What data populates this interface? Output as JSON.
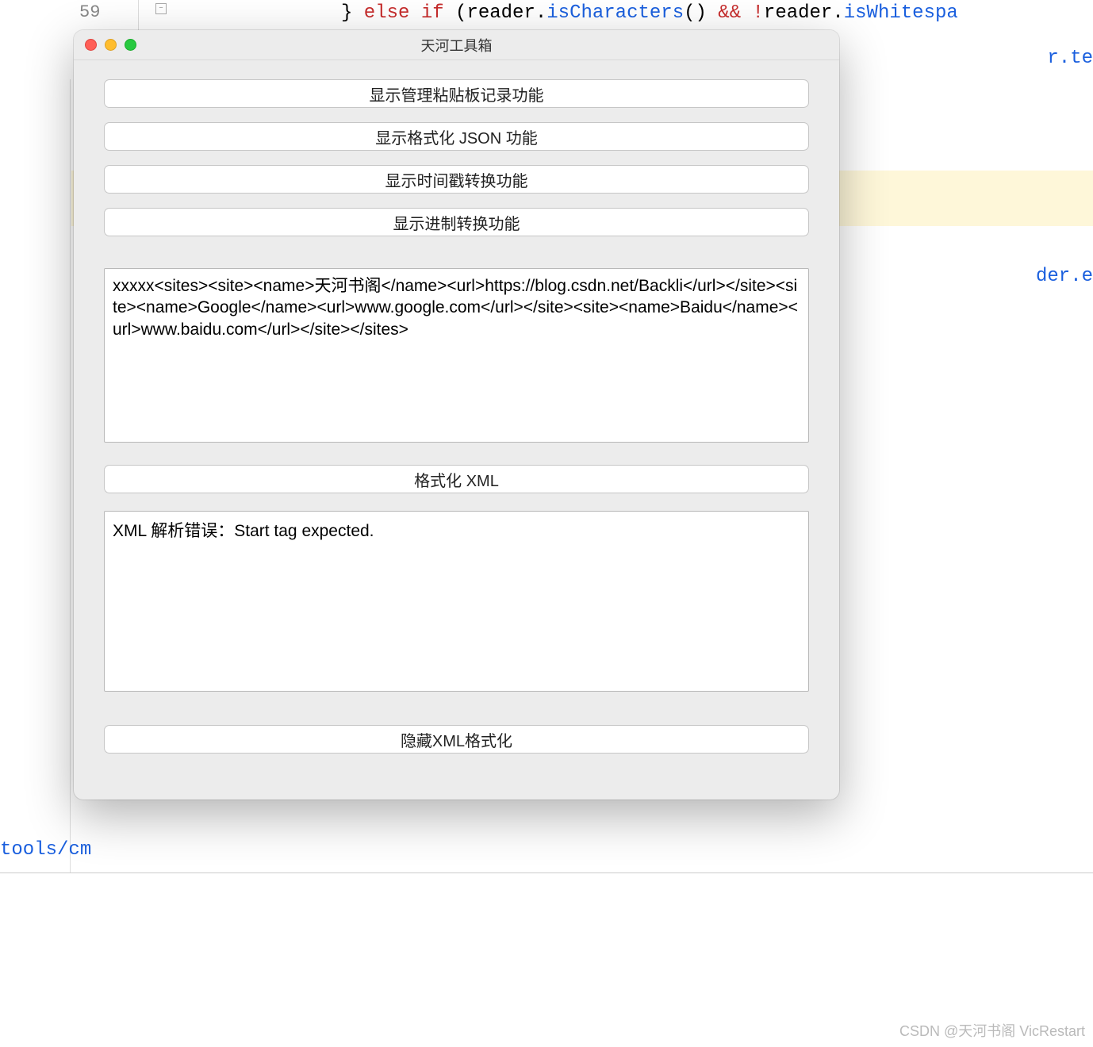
{
  "background": {
    "line_number": "59",
    "code_fragment_brace": "}",
    "code_fragment_else": " else if ",
    "code_fragment_paren1": "(",
    "code_fragment_reader": "reader",
    "code_fragment_dot": ".",
    "code_fragment_method1": "isCharacters",
    "code_fragment_call1": "()",
    "code_fragment_op": " && !",
    "code_fragment_reader2": "reader",
    "code_fragment_dot2": ".",
    "code_fragment_method2": "isWhitespa",
    "code_fragment_right1": "r.te",
    "code_fragment_right2": "der.e",
    "bottom_path": "tools/cm",
    "fold_minus": "–"
  },
  "dialog": {
    "title": "天河工具箱",
    "buttons": {
      "clipboard": "显示管理粘贴板记录功能",
      "json": "显示格式化 JSON 功能",
      "timestamp": "显示时间戳转换功能",
      "radix": "显示进制转换功能"
    },
    "xml_input": "xxxxx<sites><site><name>天河书阁</name><url>https://blog.csdn.net/Backli</url></site><site><name>Google</name><url>www.google.com</url></site><site><name>Baidu</name><url>www.baidu.com</url></site></sites>",
    "format_xml_label": "格式化 XML",
    "xml_output": "XML 解析错误：Start tag expected.",
    "hide_xml_label": "隐藏XML格式化"
  },
  "watermark": "CSDN @天河书阁 VicRestart"
}
